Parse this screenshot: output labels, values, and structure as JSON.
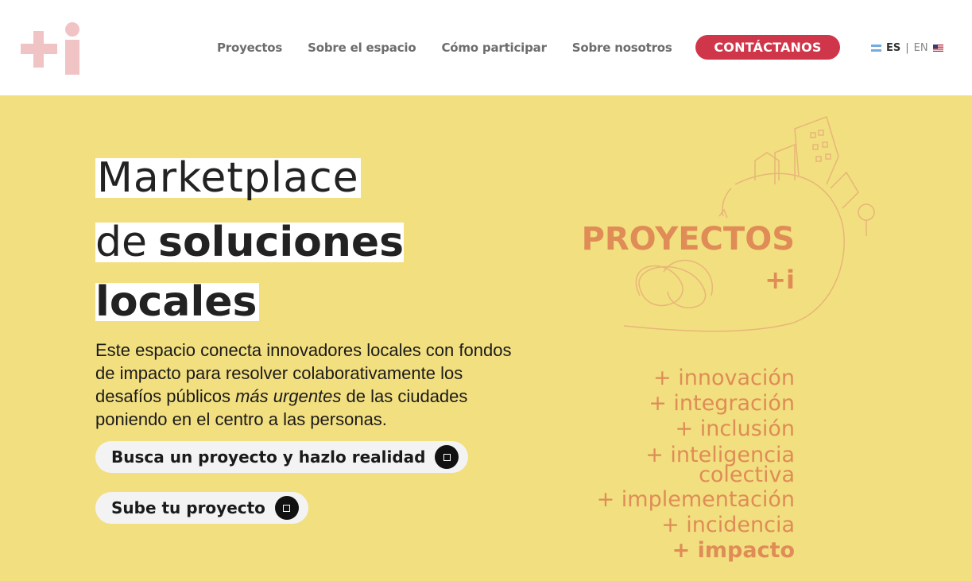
{
  "header": {
    "logo_text": "+i",
    "nav": [
      {
        "label": "Proyectos"
      },
      {
        "label": "Sobre el espacio"
      },
      {
        "label": "Cómo participar"
      },
      {
        "label": "Sobre nosotros"
      }
    ],
    "contact_label": "CONTÁCTANOS",
    "lang": {
      "es": "ES",
      "sep": "|",
      "en": "EN"
    }
  },
  "hero": {
    "title_line1": "Marketplace",
    "title_line2_thin": "de",
    "title_line2_bold": "soluciones",
    "title_line3": "locales",
    "intro_part1": "Este espacio conecta innovadores locales con fondos de impacto para resolver colaborativamente los desafíos públicos ",
    "intro_italic": "más urgentes",
    "intro_part2": " de las ciudades poniendo en el centro a las personas.",
    "btn_search": "Busca un proyecto y hazlo realidad",
    "btn_upload": "Sube tu proyecto",
    "projects_title": "PROYECTOS",
    "projects_sub": "+i",
    "values": [
      "+ innovación",
      "+ integración",
      "+ inclusión",
      "+ inteligencia",
      "colectiva",
      "+ implementación",
      "+ incidencia",
      "+ impacto"
    ]
  },
  "colors": {
    "accent": "#d0364a",
    "hero_bg": "#f2df7f",
    "orange": "#df8c57",
    "logo_pink": "#f0c4c4"
  }
}
